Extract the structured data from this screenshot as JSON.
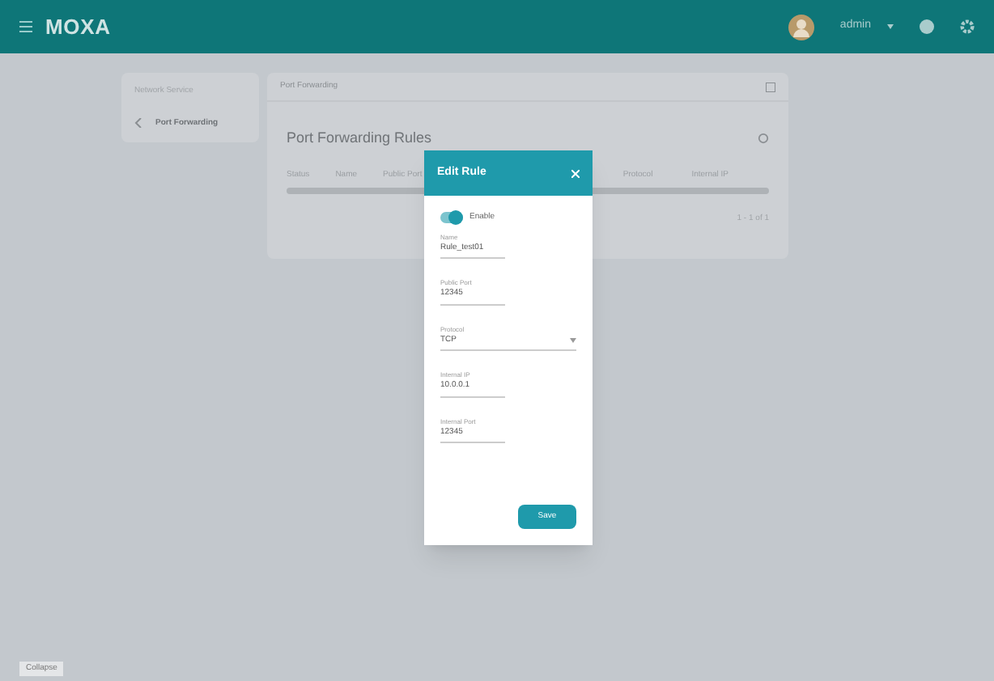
{
  "top_bar": {
    "logo": "MOXA",
    "user": "admin"
  },
  "sidebar": {
    "title": "Network Service",
    "items": [
      {
        "label": "Port Forwarding",
        "selected": true
      }
    ]
  },
  "card": {
    "breadcrumb": "Port Forwarding",
    "title": "Port Forwarding Rules",
    "toolbar": [
      "Status",
      "Name",
      "Public Port",
      "Protocol",
      "Internal IP"
    ],
    "pager": "1 - 1 of 1"
  },
  "dialog": {
    "title": "Edit Rule",
    "enable": {
      "label": "Enable",
      "on": true
    },
    "fields": [
      {
        "kind": "text",
        "label": "Name",
        "value": "Rule_test01"
      },
      {
        "kind": "text",
        "label": "Public Port",
        "value": "12345"
      },
      {
        "kind": "select",
        "label": "Protocol",
        "value": "TCP"
      },
      {
        "kind": "text",
        "label": "Internal IP",
        "value": "10.0.0.1"
      },
      {
        "kind": "text",
        "label": "Internal Port",
        "value": "12345"
      }
    ],
    "save": "Save"
  },
  "footer_button": "Collapse"
}
